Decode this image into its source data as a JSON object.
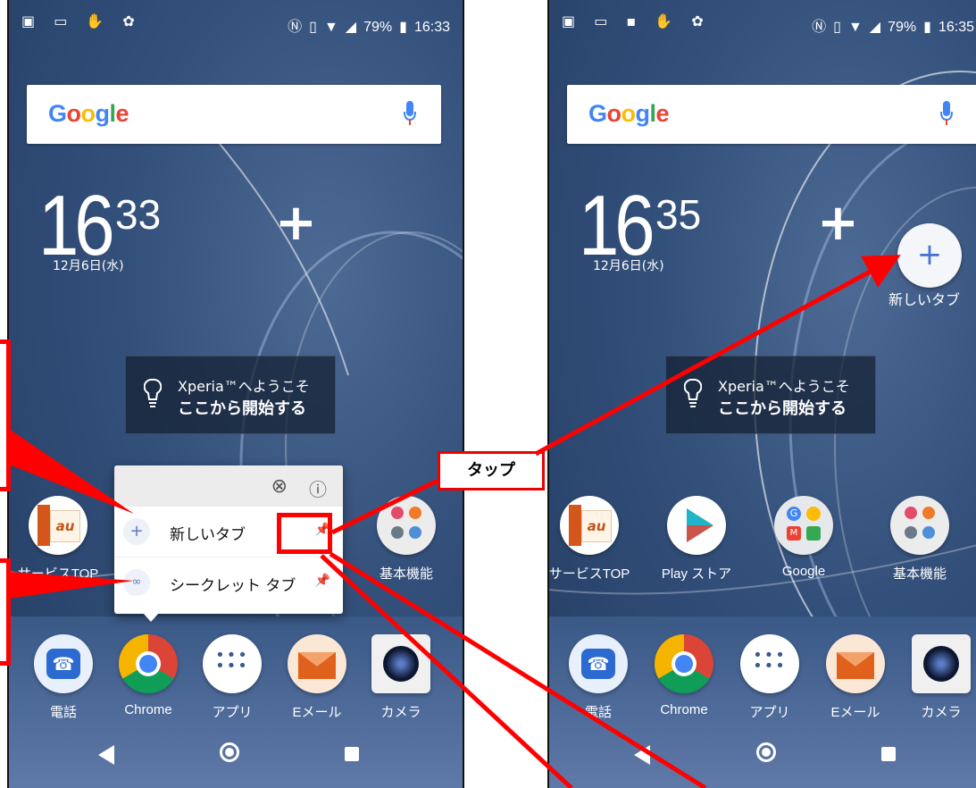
{
  "left_screen": {
    "status_time": "16:33",
    "battery": "79%",
    "search_logo": "Google",
    "clock_hour": "16",
    "clock_minute": "33",
    "clock_date": "12月6日(水)",
    "welcome_line1": "Xperia™へようこそ",
    "welcome_line2": "ここから開始する",
    "apps": [
      {
        "label": "サービスTOP",
        "icon": "au-icon"
      },
      {
        "label": "基本機能",
        "icon": "basic-functions-icon"
      }
    ],
    "dock": [
      {
        "label": "電話",
        "icon": "phone-icon"
      },
      {
        "label": "Chrome",
        "icon": "chrome-icon"
      },
      {
        "label": "アプリ",
        "icon": "apps-icon"
      },
      {
        "label": "Eメール",
        "icon": "email-icon"
      },
      {
        "label": "カメラ",
        "icon": "camera-icon"
      }
    ],
    "popup": {
      "item1": "新しいタブ",
      "item2": "シークレット タブ"
    }
  },
  "right_screen": {
    "status_time": "16:35",
    "battery": "79%",
    "search_logo": "Google",
    "clock_hour": "16",
    "clock_minute": "35",
    "clock_date": "12月6日(水)",
    "shortcut_label": "新しいタブ",
    "welcome_line1": "Xperia™へようこそ",
    "welcome_line2": "ここから開始する",
    "apps": [
      {
        "label": "サービスTOP",
        "icon": "au-icon"
      },
      {
        "label": "Play ストア",
        "icon": "play-store-icon"
      },
      {
        "label": "Google",
        "icon": "google-folder-icon"
      },
      {
        "label": "基本機能",
        "icon": "basic-functions-icon"
      }
    ],
    "dock": [
      {
        "label": "電話",
        "icon": "phone-icon"
      },
      {
        "label": "Chrome",
        "icon": "chrome-icon"
      },
      {
        "label": "アプリ",
        "icon": "apps-icon"
      },
      {
        "label": "Eメール",
        "icon": "email-icon"
      },
      {
        "label": "カメラ",
        "icon": "camera-icon"
      }
    ]
  },
  "annotation": {
    "callout": "タップ",
    "color": "#ff0000"
  }
}
